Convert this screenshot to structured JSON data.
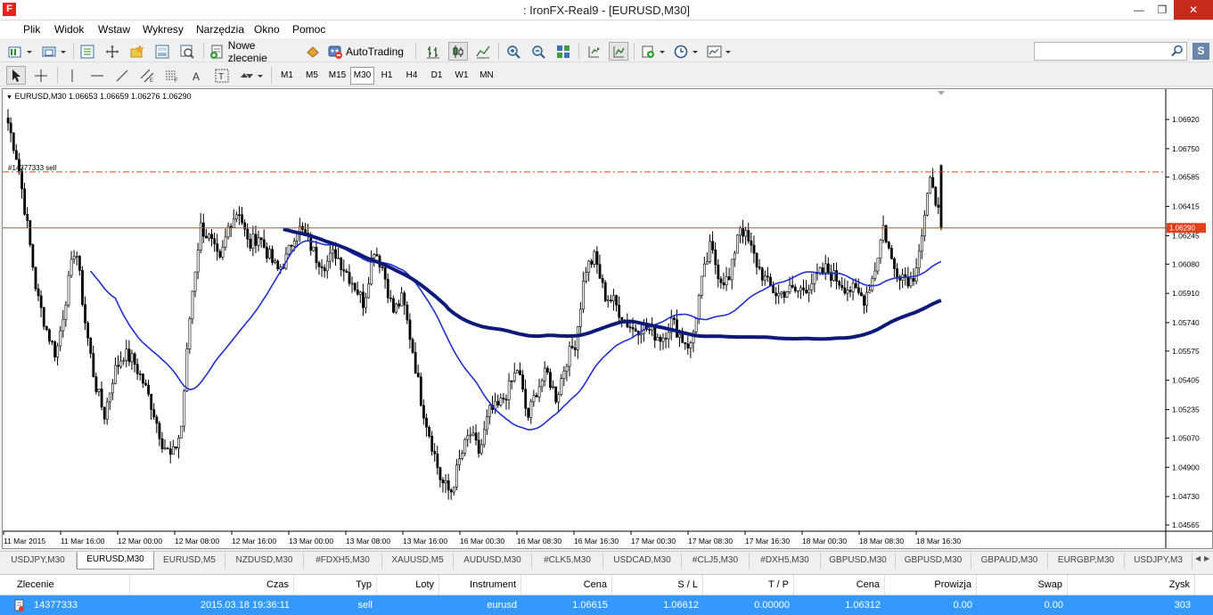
{
  "window": {
    "title": ": IronFX-Real9 - [EURUSD,M30]",
    "app_icon": "F"
  },
  "menu": [
    "Plik",
    "Widok",
    "Wstaw",
    "Wykresy",
    "Narzędzia",
    "Okno",
    "Pomoc"
  ],
  "toolbar": {
    "new_order_label": "Nowe zlecenie",
    "autotrading_label": "AutoTrading"
  },
  "timeframes": [
    "M1",
    "M5",
    "M15",
    "M30",
    "H1",
    "H4",
    "D1",
    "W1",
    "MN"
  ],
  "active_timeframe": "M30",
  "search": {
    "placeholder": ""
  },
  "chart": {
    "info": "EURUSD,M30  1.06653 1.06659 1.06276 1.06290",
    "order_line_label": "#14377333 sell",
    "current_price": "1.06290",
    "price_ticks": [
      "1.06920",
      "1.06750",
      "1.06585",
      "1.06415",
      "1.06245",
      "1.06080",
      "1.05910",
      "1.05740",
      "1.05575",
      "1.05405",
      "1.05235",
      "1.05070",
      "1.04900",
      "1.04730",
      "1.04565"
    ],
    "time_ticks": [
      "11 Mar 2015",
      "11 Mar 16:00",
      "12 Mar 00:00",
      "12 Mar 08:00",
      "12 Mar 16:00",
      "13 Mar 00:00",
      "13 Mar 08:00",
      "13 Mar 16:00",
      "16 Mar 00:30",
      "16 Mar 08:30",
      "16 Mar 16:30",
      "17 Mar 00:30",
      "17 Mar 08:30",
      "17 Mar 16:30",
      "18 Mar 00:30",
      "18 Mar 08:30",
      "18 Mar 16:30"
    ],
    "colors": {
      "bars": "#000000",
      "ma_fast": "#1f2fd0",
      "ma_slow": "#0d1a7a",
      "order_line": "#e0401a",
      "bid_line": "#b05a20",
      "price_tag": "#e0401a"
    }
  },
  "chart_data": {
    "type": "candlestick",
    "symbol": "EURUSD",
    "timeframe": "M30",
    "ohlc_last": {
      "open": 1.06653,
      "high": 1.06659,
      "low": 1.06276,
      "close": 1.0629
    },
    "ylim": [
      1.04565,
      1.07
    ],
    "order_line": 1.06615,
    "close_series": [
      1.069,
      1.0668,
      1.063,
      1.059,
      1.057,
      1.0555,
      1.0588,
      1.062,
      1.0575,
      1.054,
      1.052,
      1.0545,
      1.0556,
      1.0552,
      1.054,
      1.0525,
      1.0505,
      1.0495,
      1.0512,
      1.0585,
      1.063,
      1.0622,
      1.0608,
      1.0632,
      1.064,
      1.0618,
      1.0625,
      1.0614,
      1.0604,
      1.0612,
      1.063,
      1.0624,
      1.0612,
      1.0608,
      1.0615,
      1.0605,
      1.0596,
      1.0585,
      1.0618,
      1.0605,
      1.058,
      1.0588,
      1.056,
      1.0527,
      1.0505,
      1.0482,
      1.0475,
      1.0495,
      1.051,
      1.0498,
      1.0522,
      1.0525,
      1.0535,
      1.0548,
      1.0518,
      1.0536,
      1.0545,
      1.053,
      1.0552,
      1.0563,
      1.0605,
      1.0612,
      1.059,
      1.0586,
      1.0576,
      1.057,
      1.0572,
      1.0568,
      1.0565,
      1.0575,
      1.0565,
      1.056,
      1.0595,
      1.0618,
      1.06,
      1.0598,
      1.0632,
      1.062,
      1.0606,
      1.0596,
      1.059,
      1.0593,
      1.0592,
      1.0595,
      1.06,
      1.0605,
      1.06,
      1.0595,
      1.0592,
      1.0588,
      1.0602,
      1.063,
      1.0606,
      1.0602,
      1.0598,
      1.0625,
      1.066,
      1.0629
    ]
  },
  "symbol_tabs": [
    "USDJPY,M30",
    "EURUSD,M30",
    "EURUSD,M5",
    "NZDUSD,M30",
    "#FDXH5,M30",
    "XAUUSD,M5",
    "AUDUSD,M30",
    "#CLK5,M30",
    "USDCAD,M30",
    "#CLJ5,M30",
    "#DXH5,M30",
    "GBPUSD,M30",
    "GBPUSD,M30",
    "GBPAUD,M30",
    "EURGBP,M30",
    "USDJPY,M3"
  ],
  "active_tab": 1,
  "terminal": {
    "columns": [
      "Zlecenie",
      "Czas",
      "Typ",
      "Loty",
      "Instrument",
      "Cena",
      "S / L",
      "T / P",
      "Cena",
      "Prowizja",
      "Swap",
      "Zysk"
    ],
    "row": [
      "14377333",
      "2015.03.18 19:36:11",
      "sell",
      "",
      "eurusd",
      "1.06615",
      "1.06612",
      "0.00000",
      "1.06312",
      "0.00",
      "0.00",
      "303"
    ]
  }
}
